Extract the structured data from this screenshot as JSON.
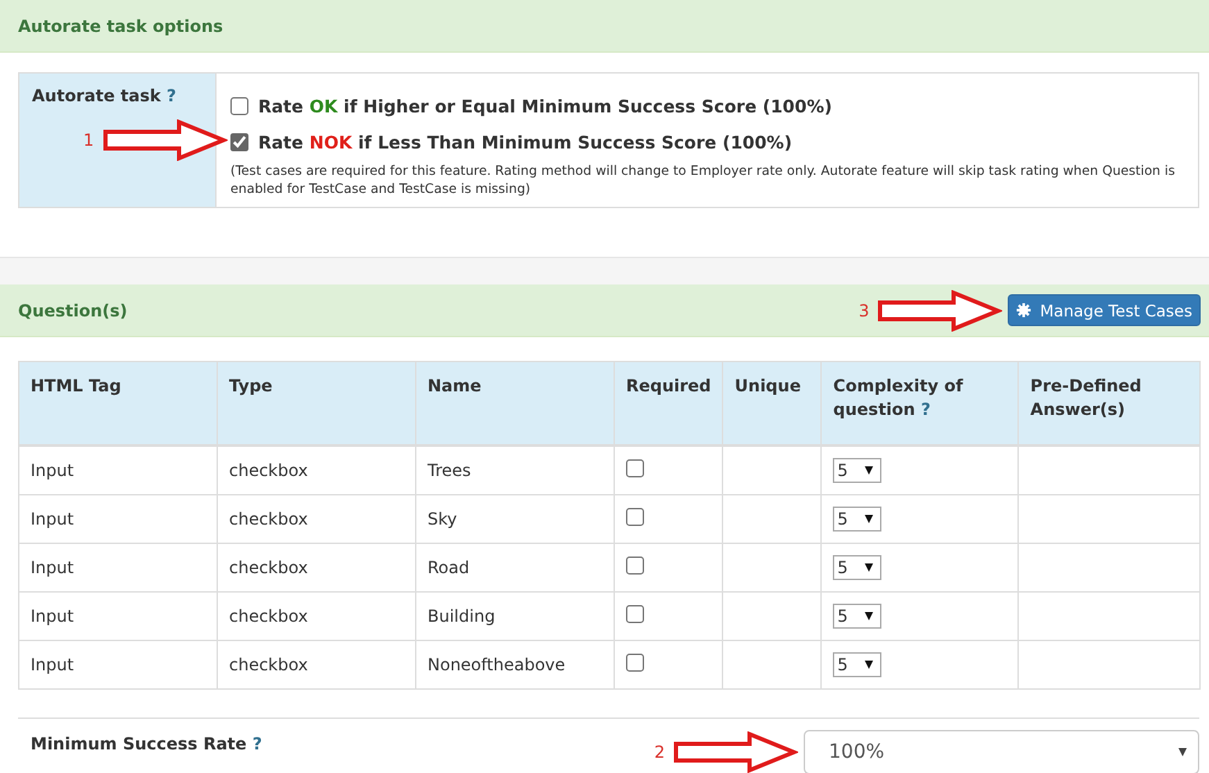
{
  "autorate_section": {
    "title": "Autorate task options",
    "label": "Autorate task",
    "help": "?",
    "options": [
      {
        "parts": [
          "Rate ",
          "OK",
          " if Higher or Equal Minimum Success Score (100%)"
        ],
        "color": "#2e8b1e",
        "checked": false
      },
      {
        "parts": [
          "Rate ",
          "NOK",
          " if Less Than Minimum Success Score (100%)"
        ],
        "color": "#e0201a",
        "checked": true,
        "annotation": "1"
      }
    ],
    "note": "(Test cases are required for this feature. Rating method will change to Employer rate only. Autorate feature will skip task rating when Question is enabled for TestCase and TestCase is missing)"
  },
  "questions_section": {
    "title": "Question(s)",
    "button": "Manage Test Cases",
    "annotation": "3",
    "columns": [
      {
        "label": "HTML Tag"
      },
      {
        "label": "Type"
      },
      {
        "label": "Name"
      },
      {
        "label": "Required"
      },
      {
        "label": "Unique"
      },
      {
        "label": "Complexity of question",
        "help": "?"
      },
      {
        "label": "Pre-Defined Answer(s)"
      }
    ],
    "rows": [
      {
        "tag": "Input",
        "type": "checkbox",
        "name": "Trees",
        "required": false,
        "complexity": "5"
      },
      {
        "tag": "Input",
        "type": "checkbox",
        "name": "Sky",
        "required": false,
        "complexity": "5"
      },
      {
        "tag": "Input",
        "type": "checkbox",
        "name": "Road",
        "required": false,
        "complexity": "5"
      },
      {
        "tag": "Input",
        "type": "checkbox",
        "name": "Building",
        "required": false,
        "complexity": "5"
      },
      {
        "tag": "Input",
        "type": "checkbox",
        "name": "Noneoftheabove",
        "required": false,
        "complexity": "5"
      }
    ]
  },
  "min_success": {
    "label": "Minimum Success Rate",
    "help": "?",
    "value": "100%",
    "annotation": "2"
  }
}
